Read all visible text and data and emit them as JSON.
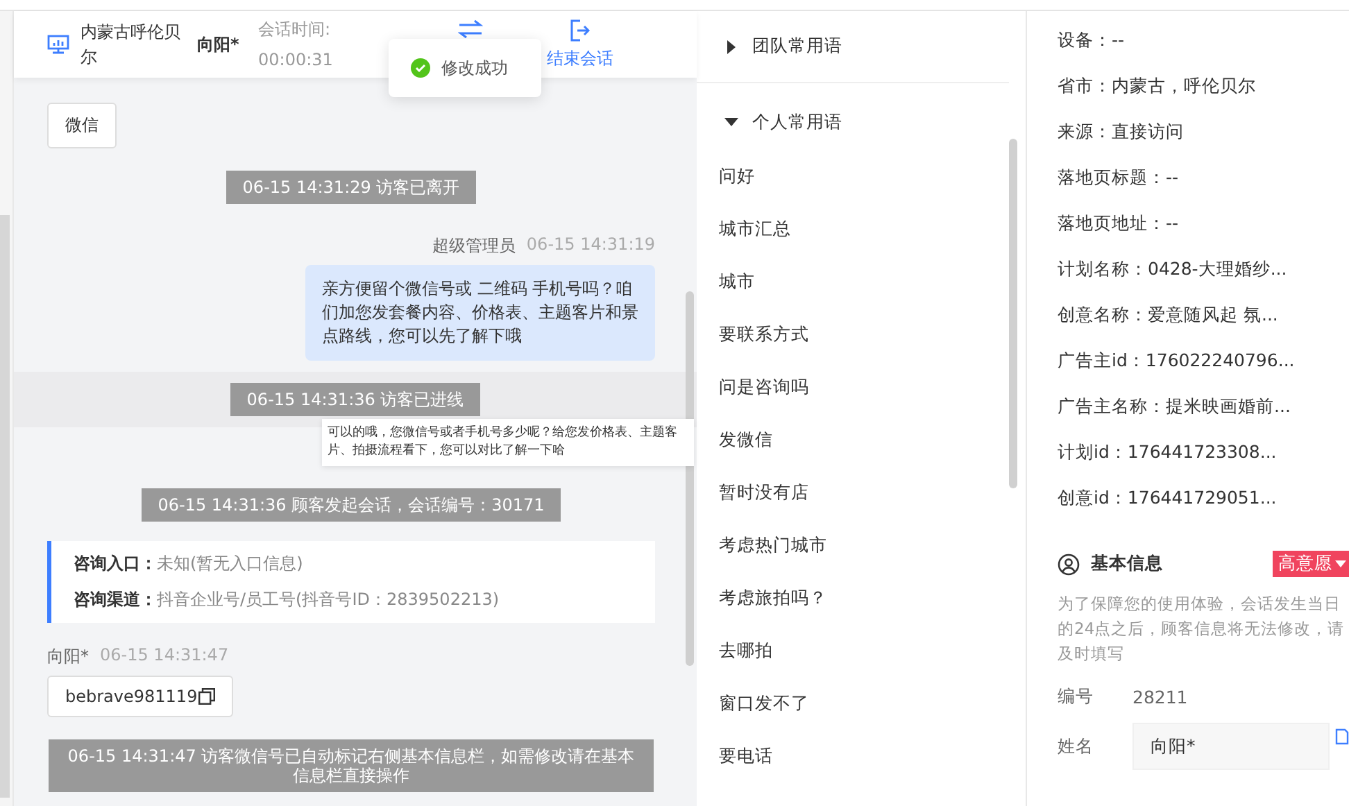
{
  "header": {
    "location": "内蒙古呼伦贝尔",
    "visitor": "向阳*",
    "session_label": "会话时间:",
    "session_time": "00:00:31",
    "end_label": "结束会话"
  },
  "toast": {
    "text": "修改成功"
  },
  "messages": [
    {
      "kind": "visitor",
      "text": "微信",
      "copyable": false
    },
    {
      "kind": "notice",
      "text": "06-15 14:31:29 访客已离开",
      "highlighted": false
    },
    {
      "kind": "agent",
      "sender": "超级管理员",
      "time": "06-15 14:31:19",
      "text": "亲方便留个微信号或 二维码 手机号吗？咱们加您发套餐内容、价格表、主题客片和景点路线，您可以先了解下哦"
    },
    {
      "kind": "notice",
      "text": "06-15 14:31:36 访客已进线",
      "highlighted": true
    },
    {
      "kind": "notice",
      "text": "06-15 14:31:36 顾客发起会话，会话编号：30171",
      "highlighted": false
    },
    {
      "kind": "source",
      "rows": [
        {
          "label": "咨询入口：",
          "value": "未知(暂无入口信息)"
        },
        {
          "label": "咨询渠道：",
          "value": "抖音企业号/员工号(抖音号ID：2839502213)"
        }
      ]
    },
    {
      "kind": "visitor",
      "sender": "向阳*",
      "time": "06-15 14:31:47",
      "text": "bebrave981119",
      "copyable": true
    },
    {
      "kind": "notice",
      "text": "06-15 14:31:47 访客微信号已自动标记右侧基本信息栏，如需修改请在基本信息栏直接操作",
      "highlighted": false
    }
  ],
  "tooltip": {
    "text": "可以的哦，您微信号或者手机号多少呢？给您发价格表、主题客片、拍摄流程看下，您可以对比了解一下哈"
  },
  "phrases": [
    {
      "title": "团队常用语",
      "expanded": false
    },
    {
      "title": "个人常用语",
      "expanded": true,
      "items": [
        "问好",
        "城市汇总",
        "城市",
        "要联系方式",
        "问是咨询吗",
        "发微信",
        "暂时没有店",
        "考虑热门城市",
        "考虑旅拍吗？",
        "去哪拍",
        "窗口发不了",
        "要电话"
      ]
    }
  ],
  "info": {
    "fields": [
      "设备：--",
      "省市：内蒙古，呼伦贝尔",
      "来源：直接访问",
      "落地页标题：--",
      "落地页地址：--",
      "计划名称：0428-大理婚纱...",
      "创意名称：爱意随风起 氛...",
      "广告主id：176022240796...",
      "广告主名称：提米映画婚前...",
      "计划id：176441723308...",
      "创意id：176441729051..."
    ],
    "basic": {
      "title": "基本信息",
      "tag": "高意愿",
      "note": "为了保障您的使用体验，会话发生当日的24点之后，顾客信息将无法修改，请及时填写",
      "number_label": "编号",
      "number": "28211",
      "name_label": "姓名",
      "name_value": "向阳*"
    }
  }
}
